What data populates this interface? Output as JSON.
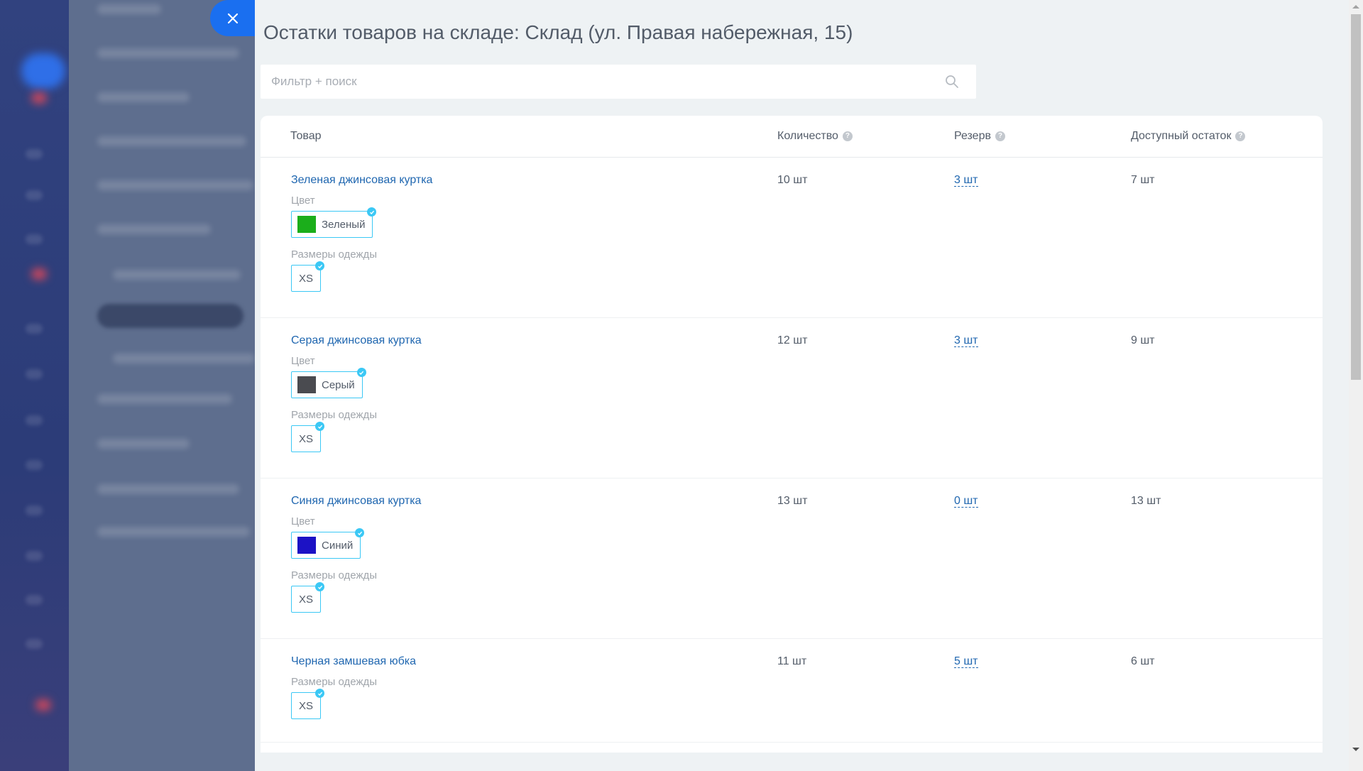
{
  "panel": {
    "title": "Остатки товаров на складе: Склад (ул. Правая набережная, 15)"
  },
  "search": {
    "placeholder": "Фильтр + поиск",
    "value": ""
  },
  "table": {
    "headers": {
      "product": "Товар",
      "quantity": "Количество",
      "reserve": "Резерв",
      "available": "Доступный остаток"
    },
    "color_label": "Цвет",
    "size_label": "Размеры одежды",
    "rows": [
      {
        "name": "Зеленая джинсовая куртка",
        "color": "Зеленый",
        "color_hex": "#1bae1b",
        "size": "XS",
        "quantity": "10 шт",
        "reserve": "3 шт",
        "available": "7 шт"
      },
      {
        "name": "Серая джинсовая куртка",
        "color": "Серый",
        "color_hex": "#4a4b50",
        "size": "XS",
        "quantity": "12 шт",
        "reserve": "3 шт",
        "available": "9 шт"
      },
      {
        "name": "Синяя джинсовая куртка",
        "color": "Синий",
        "color_hex": "#1c12c5",
        "size": "XS",
        "quantity": "13 шт",
        "reserve": "0 шт",
        "available": "13 шт"
      },
      {
        "name": "Черная замшевая юбка",
        "color": "",
        "color_hex": "",
        "size": "XS",
        "quantity": "11 шт",
        "reserve": "5 шт",
        "available": "6 шт"
      }
    ]
  },
  "icons": {
    "close": "close-icon",
    "search": "search-icon",
    "help": "question-icon",
    "check": "check-icon"
  },
  "colors": {
    "accent": "#1a6ff0",
    "link": "#2067b0",
    "chip_border": "#3bc8f5"
  }
}
